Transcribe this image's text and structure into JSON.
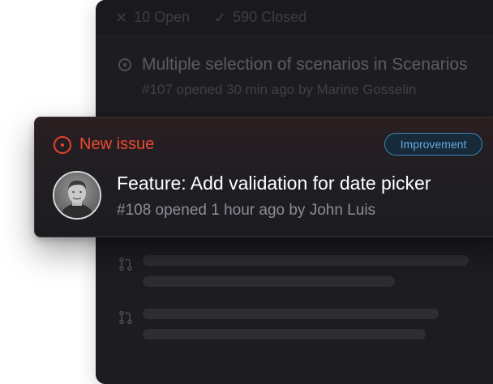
{
  "filters": {
    "open_label": "10 Open",
    "closed_label": "590 Closed"
  },
  "background_issue": {
    "title": "Multiple selection of scenarios in Scenarios",
    "meta": "#107 opened 30 min ago by Marine Gosselin"
  },
  "card": {
    "status_label": "New issue",
    "badge_label": "Improvement",
    "title": "Feature: Add validation for date picker",
    "meta": "#108 opened 1 hour ago by John Luis"
  },
  "colors": {
    "accent_red": "#ea4a30",
    "badge_blue": "#63a9de",
    "panel_bg": "#1d1d21"
  },
  "icons": {
    "open_filter": "close-x-icon",
    "closed_filter": "checkmark-icon",
    "issue": "issue-open-icon",
    "placeholder_rows": "pull-request-icon"
  }
}
